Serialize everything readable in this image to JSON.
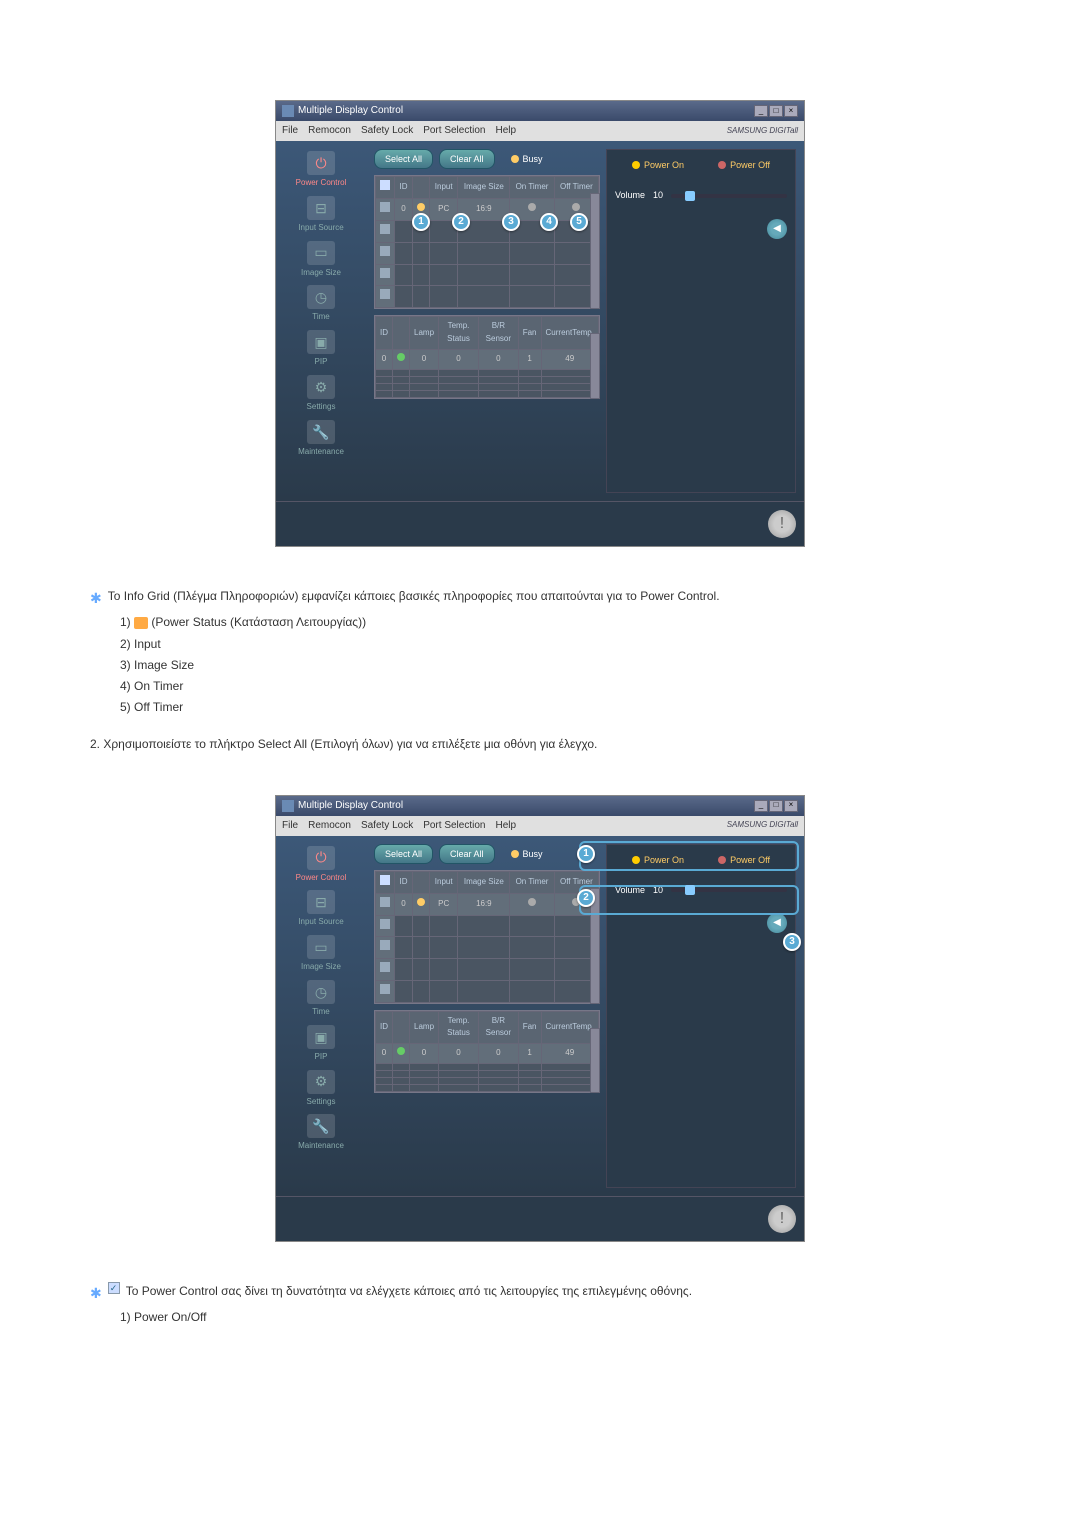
{
  "app": {
    "title": "Multiple Display Control",
    "menu": {
      "file": "File",
      "remocon": "Remocon",
      "safety_lock": "Safety Lock",
      "port_selection": "Port Selection",
      "help": "Help"
    },
    "brand": "SAMSUNG DIGITall"
  },
  "sidebar": {
    "power_control": "Power Control",
    "input_source": "Input Source",
    "image_size": "Image Size",
    "time": "Time",
    "pip": "PIP",
    "settings": "Settings",
    "maintenance": "Maintenance"
  },
  "buttons": {
    "select_all": "Select All",
    "clear_all": "Clear All",
    "busy": "Busy"
  },
  "grid1": {
    "headers": {
      "check": "✓",
      "id": "ID",
      "status": "",
      "input": "Input",
      "image_size": "Image Size",
      "on_timer": "On Timer",
      "off_timer": "Off Timer"
    },
    "row": {
      "id": "0",
      "input": "PC",
      "image_size": "16:9"
    }
  },
  "grid2": {
    "headers": {
      "id": "ID",
      "status": "",
      "lamp": "Lamp",
      "temp_status": "Temp. Status",
      "br_sensor": "B/R Sensor",
      "fan": "Fan",
      "current_temp": "CurrentTemp."
    },
    "row": {
      "id": "0",
      "lamp": "0",
      "temp_status": "0",
      "br_sensor": "0",
      "fan": "1",
      "current_temp": "49"
    }
  },
  "panel": {
    "power_on": "Power On",
    "power_off": "Power Off",
    "volume_label": "Volume",
    "volume_value": "10"
  },
  "badges": {
    "n1": "1",
    "n2": "2",
    "n3": "3",
    "n4": "4",
    "n5": "5"
  },
  "doc": {
    "p1": "Το Info Grid (Πλέγμα Πληροφοριών) εμφανίζει κάποιες βασικές πληροφορίες που απαιτούνται για το Power Control.",
    "l1_prefix": "1) ",
    "l1_suffix": " (Power Status (Κατάσταση Λειτουργίας))",
    "l2": "2) Input",
    "l3": "3) Image Size",
    "l4": "4) On Timer",
    "l5": "5) Off Timer",
    "p2": "2.  Χρησιμοποιείστε το πλήκτρο Select All (Επιλογή όλων) για να επιλέξετε μια οθόνη για έλεγχο.",
    "p3": " Το Power Control σας δίνει τη δυνατότητα να ελέγχετε κάποιες από τις λειτουργίες της επιλεγμένης οθόνης.",
    "l_power_onoff": "1)  Power On/Off"
  }
}
